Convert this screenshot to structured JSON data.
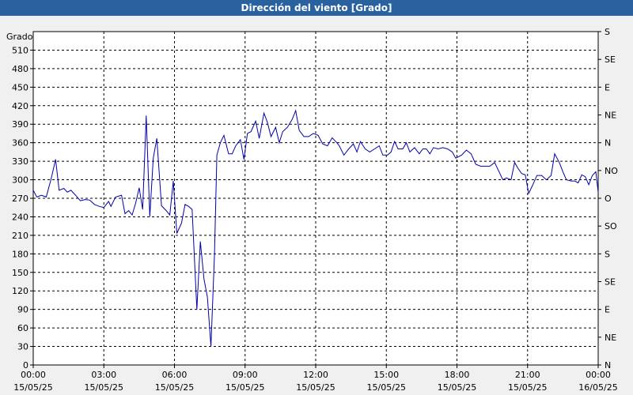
{
  "window": {
    "title": "Dirección del viento [Grado]"
  },
  "chart_data": {
    "type": "line",
    "title": "Dirección del viento [Grado]",
    "ylabel": "Grado",
    "ylim": [
      0,
      540
    ],
    "yticks": [
      0,
      30,
      60,
      90,
      120,
      150,
      180,
      210,
      240,
      270,
      300,
      330,
      360,
      390,
      420,
      450,
      480,
      510
    ],
    "right_axis": {
      "labels": [
        {
          "value": 0,
          "text": "N"
        },
        {
          "value": 45,
          "text": "NE"
        },
        {
          "value": 90,
          "text": "E"
        },
        {
          "value": 135,
          "text": "SE"
        },
        {
          "value": 180,
          "text": "S"
        },
        {
          "value": 225,
          "text": "SO"
        },
        {
          "value": 270,
          "text": "O"
        },
        {
          "value": 315,
          "text": "NO"
        },
        {
          "value": 360,
          "text": "N"
        },
        {
          "value": 405,
          "text": "NE"
        },
        {
          "value": 450,
          "text": "E"
        },
        {
          "value": 495,
          "text": "SE"
        },
        {
          "value": 540,
          "text": "S"
        }
      ]
    },
    "xlim_hours": [
      0,
      24
    ],
    "xticks": [
      {
        "hour": 0,
        "time": "00:00",
        "date": "15/05/25"
      },
      {
        "hour": 3,
        "time": "03:00",
        "date": "15/05/25"
      },
      {
        "hour": 6,
        "time": "06:00",
        "date": "15/05/25"
      },
      {
        "hour": 9,
        "time": "09:00",
        "date": "15/05/25"
      },
      {
        "hour": 12,
        "time": "12:00",
        "date": "15/05/25"
      },
      {
        "hour": 15,
        "time": "15:00",
        "date": "15/05/25"
      },
      {
        "hour": 18,
        "time": "18:00",
        "date": "15/05/25"
      },
      {
        "hour": 21,
        "time": "21:00",
        "date": "15/05/25"
      },
      {
        "hour": 24,
        "time": "00:00",
        "date": "16/05/25"
      }
    ],
    "grid": true,
    "series": [
      {
        "color": "#0000aa",
        "points": [
          [
            0.0,
            283
          ],
          [
            0.15,
            272
          ],
          [
            0.35,
            275
          ],
          [
            0.55,
            272
          ],
          [
            0.75,
            300
          ],
          [
            0.95,
            333
          ],
          [
            1.1,
            283
          ],
          [
            1.3,
            286
          ],
          [
            1.45,
            280
          ],
          [
            1.6,
            283
          ],
          [
            1.8,
            275
          ],
          [
            2.0,
            266
          ],
          [
            2.2,
            268
          ],
          [
            2.4,
            267
          ],
          [
            2.6,
            260
          ],
          [
            2.8,
            257
          ],
          [
            3.0,
            255
          ],
          [
            3.2,
            265
          ],
          [
            3.3,
            257
          ],
          [
            3.5,
            272
          ],
          [
            3.75,
            275
          ],
          [
            3.9,
            245
          ],
          [
            4.05,
            250
          ],
          [
            4.2,
            243
          ],
          [
            4.35,
            262
          ],
          [
            4.5,
            287
          ],
          [
            4.65,
            252
          ],
          [
            4.8,
            404
          ],
          [
            4.95,
            240
          ],
          [
            5.1,
            335
          ],
          [
            5.25,
            367
          ],
          [
            5.45,
            258
          ],
          [
            5.65,
            250
          ],
          [
            5.8,
            243
          ],
          [
            5.95,
            298
          ],
          [
            6.1,
            213
          ],
          [
            6.3,
            230
          ],
          [
            6.45,
            260
          ],
          [
            6.6,
            257
          ],
          [
            6.75,
            252
          ],
          [
            6.95,
            90
          ],
          [
            7.1,
            200
          ],
          [
            7.25,
            140
          ],
          [
            7.4,
            110
          ],
          [
            7.55,
            30
          ],
          [
            7.7,
            180
          ],
          [
            7.8,
            340
          ],
          [
            7.95,
            360
          ],
          [
            8.1,
            372
          ],
          [
            8.3,
            342
          ],
          [
            8.45,
            342
          ],
          [
            8.6,
            355
          ],
          [
            8.8,
            365
          ],
          [
            8.95,
            333
          ],
          [
            9.1,
            375
          ],
          [
            9.25,
            378
          ],
          [
            9.45,
            395
          ],
          [
            9.6,
            367
          ],
          [
            9.8,
            408
          ],
          [
            9.95,
            393
          ],
          [
            10.1,
            370
          ],
          [
            10.3,
            385
          ],
          [
            10.45,
            360
          ],
          [
            10.6,
            378
          ],
          [
            10.8,
            385
          ],
          [
            11.0,
            398
          ],
          [
            11.15,
            412
          ],
          [
            11.3,
            380
          ],
          [
            11.5,
            370
          ],
          [
            11.7,
            370
          ],
          [
            11.9,
            375
          ],
          [
            12.1,
            372
          ],
          [
            12.3,
            358
          ],
          [
            12.5,
            355
          ],
          [
            12.7,
            368
          ],
          [
            12.9,
            360
          ],
          [
            13.0,
            355
          ],
          [
            13.2,
            340
          ],
          [
            13.4,
            350
          ],
          [
            13.6,
            358
          ],
          [
            13.75,
            345
          ],
          [
            13.9,
            362
          ],
          [
            14.1,
            350
          ],
          [
            14.3,
            345
          ],
          [
            14.5,
            350
          ],
          [
            14.7,
            355
          ],
          [
            14.85,
            340
          ],
          [
            15.05,
            340
          ],
          [
            15.2,
            345
          ],
          [
            15.35,
            362
          ],
          [
            15.5,
            350
          ],
          [
            15.7,
            350
          ],
          [
            15.85,
            360
          ],
          [
            16.0,
            345
          ],
          [
            16.2,
            352
          ],
          [
            16.4,
            342
          ],
          [
            16.55,
            350
          ],
          [
            16.7,
            350
          ],
          [
            16.85,
            342
          ],
          [
            17.0,
            352
          ],
          [
            17.2,
            350
          ],
          [
            17.4,
            352
          ],
          [
            17.6,
            350
          ],
          [
            17.8,
            345
          ],
          [
            17.95,
            335
          ],
          [
            18.2,
            340
          ],
          [
            18.4,
            348
          ],
          [
            18.6,
            342
          ],
          [
            18.8,
            325
          ],
          [
            19.0,
            322
          ],
          [
            19.2,
            322
          ],
          [
            19.4,
            322
          ],
          [
            19.6,
            328
          ],
          [
            19.8,
            312
          ],
          [
            19.95,
            300
          ],
          [
            20.1,
            303
          ],
          [
            20.3,
            300
          ],
          [
            20.45,
            328
          ],
          [
            20.6,
            318
          ],
          [
            20.75,
            310
          ],
          [
            20.9,
            308
          ],
          [
            21.05,
            278
          ],
          [
            21.2,
            290
          ],
          [
            21.4,
            307
          ],
          [
            21.6,
            307
          ],
          [
            21.8,
            300
          ],
          [
            22.0,
            307
          ],
          [
            22.15,
            342
          ],
          [
            22.35,
            328
          ],
          [
            22.5,
            313
          ],
          [
            22.65,
            300
          ],
          [
            22.85,
            298
          ],
          [
            23.0,
            298
          ],
          [
            23.15,
            295
          ],
          [
            23.3,
            308
          ],
          [
            23.45,
            305
          ],
          [
            23.6,
            292
          ],
          [
            23.75,
            307
          ],
          [
            23.9,
            313
          ],
          [
            24.0,
            280
          ]
        ]
      }
    ]
  }
}
